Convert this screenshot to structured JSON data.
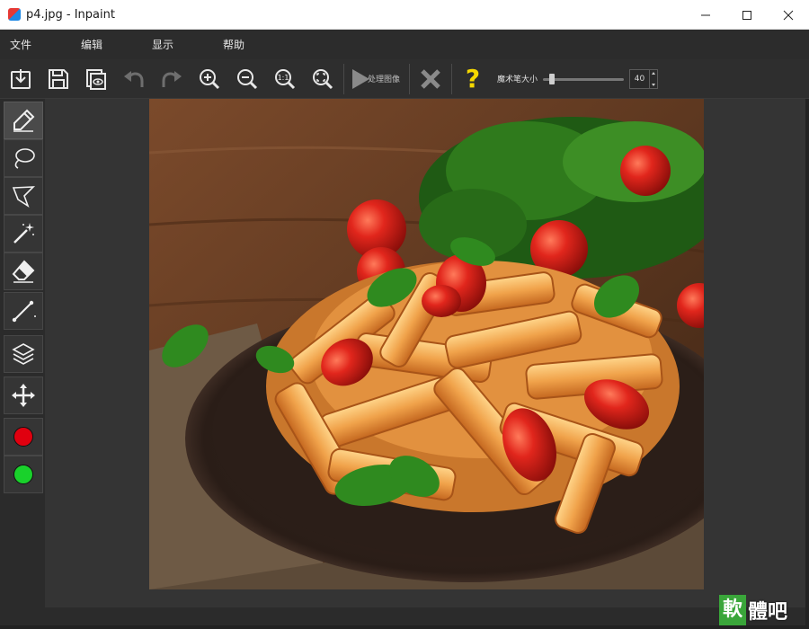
{
  "window": {
    "title": "p4.jpg - Inpaint",
    "controls": [
      "minimize-icon",
      "maximize-icon",
      "close-icon"
    ]
  },
  "menu": {
    "items": [
      "文件",
      "编辑",
      "显示",
      "帮助"
    ]
  },
  "toolbar": {
    "buttons": [
      "open-icon",
      "save-icon",
      "save-copy-icon",
      "undo-icon",
      "redo-icon",
      "zoom-in-icon",
      "zoom-out-icon",
      "actual-size-icon",
      "fit-window-icon"
    ],
    "process_label": "处理图像",
    "help_glyph": "?",
    "brush_size_label": "魔术笔大小",
    "brush_size_value": "40",
    "brush_size_min": 1,
    "brush_size_max": 100
  },
  "sidebar": {
    "tools": [
      "marker-icon",
      "lasso-icon",
      "polygonal-lasso-icon",
      "magic-wand-icon",
      "eraser-icon",
      "guide-lines-icon",
      "layers-icon",
      "move-icon"
    ],
    "active_tool": "marker-icon",
    "colors": {
      "red": "#e0000f",
      "green": "#19d12b"
    }
  },
  "watermark": {
    "main": "軟",
    "rest": "體吧"
  },
  "colors": {
    "toolbar_bg": "#2e2e2e",
    "canvas_bg": "#343434",
    "help_yellow": "#f5d800"
  }
}
